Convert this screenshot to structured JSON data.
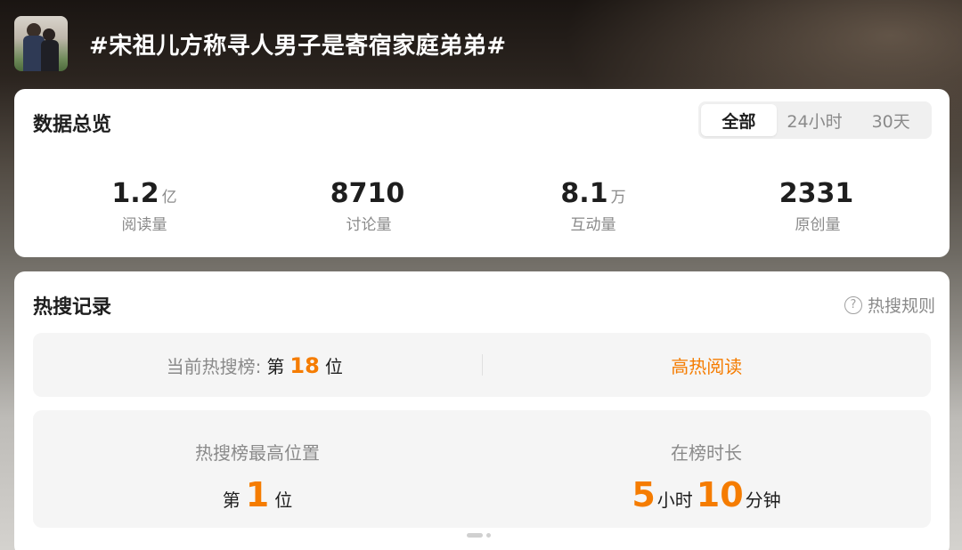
{
  "header": {
    "title": "#宋祖儿方称寻人男子是寄宿家庭弟弟#"
  },
  "overview": {
    "title": "数据总览",
    "tabs": [
      {
        "label": "全部",
        "active": true
      },
      {
        "label": "24小时",
        "active": false
      },
      {
        "label": "30天",
        "active": false
      }
    ],
    "stats": [
      {
        "value": "1.2",
        "unit": "亿",
        "label": "阅读量"
      },
      {
        "value": "8710",
        "unit": "",
        "label": "讨论量"
      },
      {
        "value": "8.1",
        "unit": "万",
        "label": "互动量"
      },
      {
        "value": "2331",
        "unit": "",
        "label": "原创量"
      }
    ]
  },
  "hot_search": {
    "title": "热搜记录",
    "rules_label": "热搜规则",
    "current_rank": {
      "label": "当前热搜榜:",
      "prefix": "第",
      "value": "18",
      "suffix": "位"
    },
    "read_link": "高热阅读",
    "highest": {
      "label": "热搜榜最高位置",
      "prefix": "第",
      "value": "1",
      "suffix": "位"
    },
    "duration": {
      "label": "在榜时长",
      "hours": "5",
      "hours_unit": "小时",
      "minutes": "10",
      "minutes_unit": "分钟"
    }
  },
  "colors": {
    "accent": "#f57c00",
    "text_primary": "#1e1e1e",
    "text_secondary": "#8a8a8a",
    "card_bg": "#ffffff",
    "panel_bg": "#f5f5f5"
  },
  "icons": {
    "help": "question-circle-icon"
  }
}
